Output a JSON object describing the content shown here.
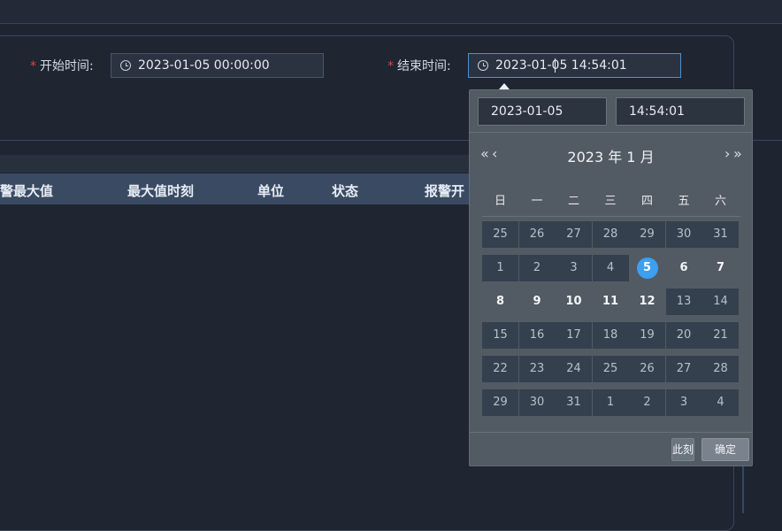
{
  "form": {
    "start": {
      "required_mark": "*",
      "label": "开始时间:",
      "value": "2023-01-05 00:00:00"
    },
    "end": {
      "required_mark": "*",
      "label": "结束时间:",
      "value": "2023-01-05 14:54:01"
    }
  },
  "table": {
    "headers": [
      "警最大值",
      "最大值时刻",
      "单位",
      "状态",
      "报警开"
    ]
  },
  "bottom_text": "",
  "picker": {
    "date_value": "2023-01-05",
    "time_value": "14:54:01",
    "nav": {
      "prev_year": "«",
      "prev_month": "‹",
      "next_month": "›",
      "next_year": "»"
    },
    "title": "2023 年  1 月",
    "weekdays": [
      "日",
      "一",
      "二",
      "三",
      "四",
      "五",
      "六"
    ],
    "weeks": [
      [
        "25",
        "26",
        "27",
        "28",
        "29",
        "30",
        "31"
      ],
      [
        "1",
        "2",
        "3",
        "4",
        "5",
        "6",
        "7"
      ],
      [
        "8",
        "9",
        "10",
        "11",
        "12",
        "13",
        "14"
      ],
      [
        "15",
        "16",
        "17",
        "18",
        "19",
        "20",
        "21"
      ],
      [
        "22",
        "23",
        "24",
        "25",
        "26",
        "27",
        "28"
      ],
      [
        "29",
        "30",
        "31",
        "1",
        "2",
        "3",
        "4"
      ]
    ],
    "selected_day": "5",
    "now_button": "此刻",
    "ok_button": "确定"
  },
  "colors": {
    "accent": "#3d9ff0",
    "required": "#e0453d",
    "header_bg": "#3a4a63"
  }
}
